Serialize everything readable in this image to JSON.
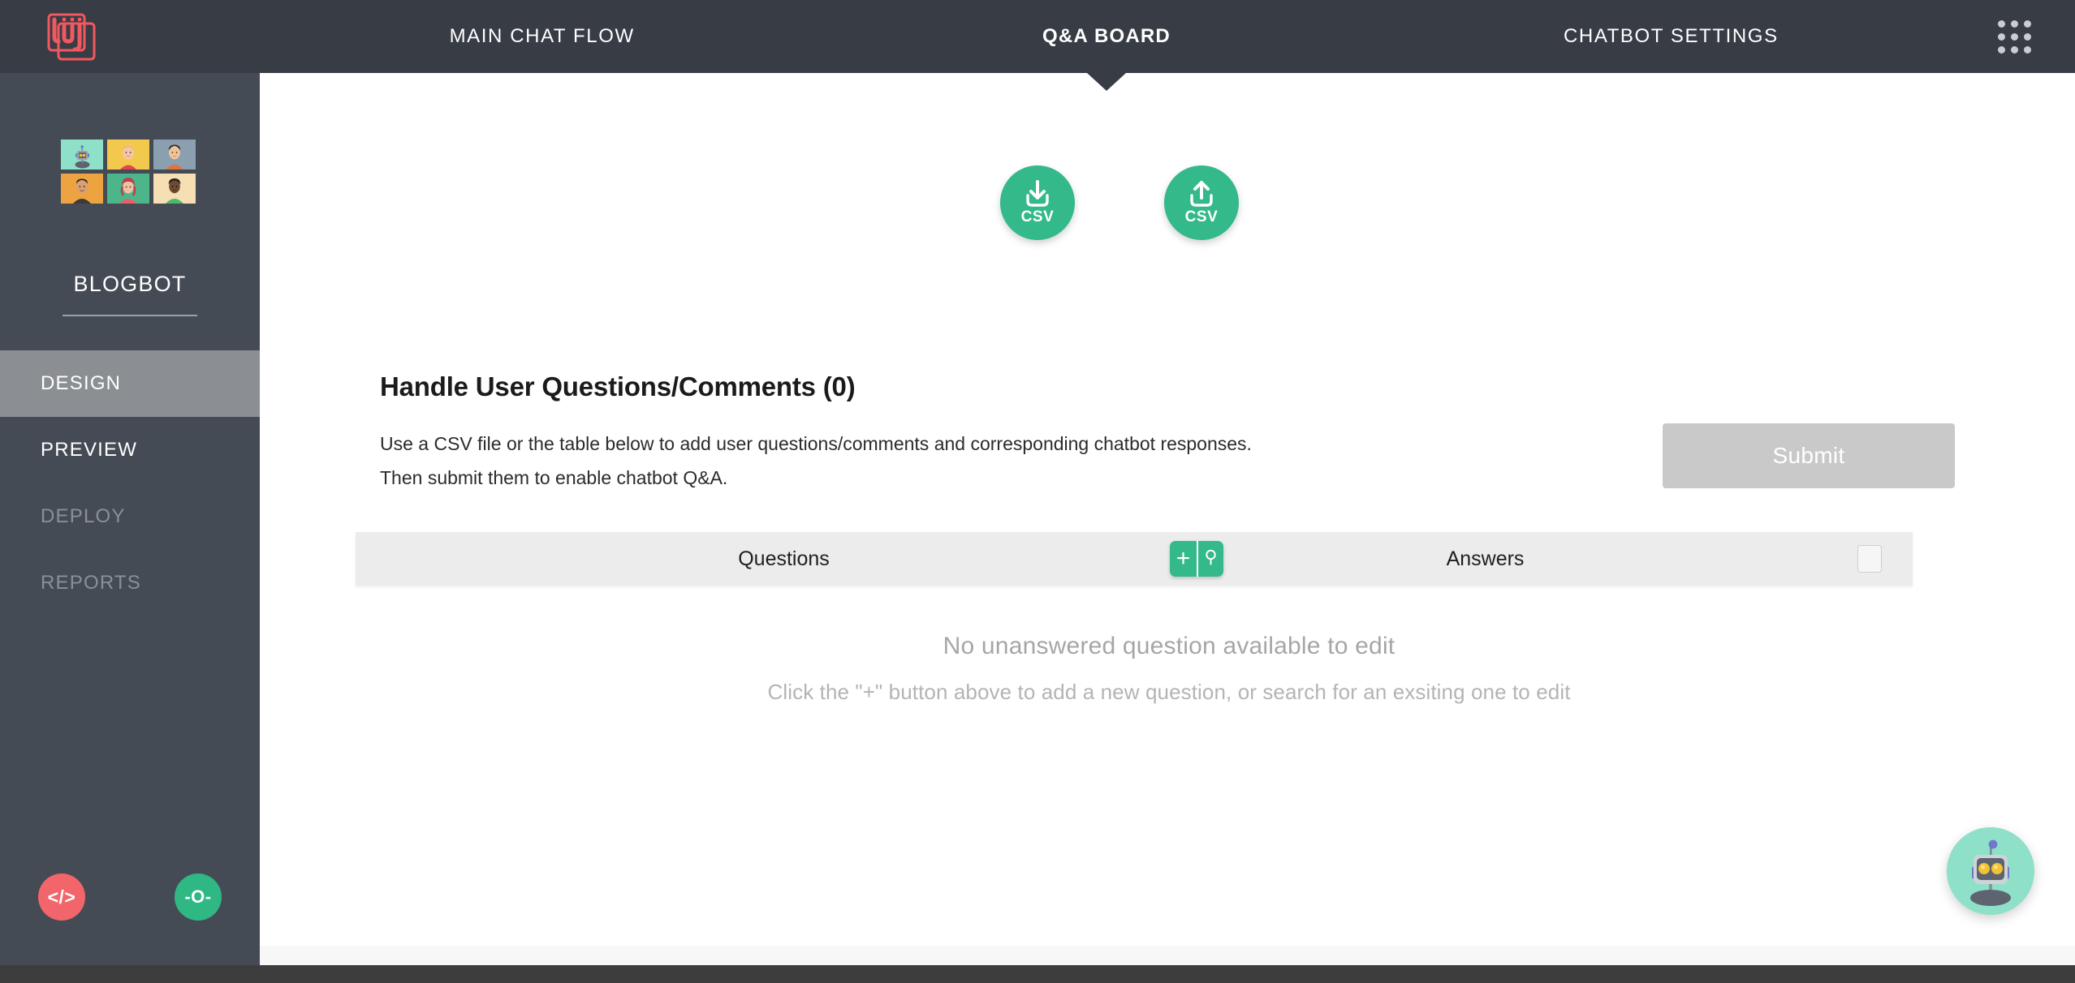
{
  "topnav": {
    "logo_alt": "Juji",
    "items": [
      {
        "label": "MAIN CHAT FLOW",
        "active": false
      },
      {
        "label": "Q&A BOARD",
        "active": true
      },
      {
        "label": "CHATBOT SETTINGS",
        "active": false
      }
    ],
    "grid_menu_icon": "apps-grid-icon"
  },
  "sidebar": {
    "bot_name": "BLOGBOT",
    "avatars": [
      {
        "name": "avatar-robot",
        "bg": "#8fe0c8"
      },
      {
        "name": "avatar-woman-red",
        "bg": "#f2c94c"
      },
      {
        "name": "avatar-man-orange",
        "bg": "#8a9fb0"
      },
      {
        "name": "avatar-man-dark",
        "bg": "#eda33f"
      },
      {
        "name": "avatar-woman-curly",
        "bg": "#4cb68a"
      },
      {
        "name": "avatar-woman-green",
        "bg": "#f6dfb3"
      }
    ],
    "items": [
      {
        "label": "DESIGN",
        "state": "active"
      },
      {
        "label": "PREVIEW",
        "state": "enabled"
      },
      {
        "label": "DEPLOY",
        "state": "disabled"
      },
      {
        "label": "REPORTS",
        "state": "disabled"
      }
    ],
    "fabs": [
      {
        "label": "</>",
        "name": "code-button",
        "color": "#f2656b"
      },
      {
        "label": "-O-",
        "name": "node-button",
        "color": "#2fb784"
      }
    ]
  },
  "main": {
    "csv_buttons": [
      {
        "label": "CSV",
        "icon": "download-icon",
        "name": "download-csv-button"
      },
      {
        "label": "CSV",
        "icon": "upload-icon",
        "name": "upload-csv-button"
      }
    ],
    "panel_title": "Handle User Questions/Comments (0)",
    "panel_description": "Use a CSV file or the table below to add user questions/comments and corresponding chatbot responses. Then submit them to enable chatbot Q&A.",
    "submit_label": "Submit",
    "submit_disabled": true,
    "table": {
      "columns": [
        "Questions",
        "Answers"
      ],
      "add_label": "+",
      "search_icon": "search-icon",
      "select_all_checked": false,
      "rows": []
    },
    "empty_state": {
      "line1": "No unanswered question available to edit",
      "line2": "Click the \"+\" button above to add a new question, or search for an exsiting one to edit"
    }
  },
  "bot_widget": {
    "name": "chatbot-avatar-widget",
    "bg": "#8fe0c8"
  },
  "colors": {
    "nav_dark": "#383c45",
    "sidebar_dark": "#454b55",
    "accent_green": "#33b98a",
    "accent_red": "#f2656b",
    "disabled_gray": "#c9c9c9",
    "table_header": "#ececec"
  }
}
